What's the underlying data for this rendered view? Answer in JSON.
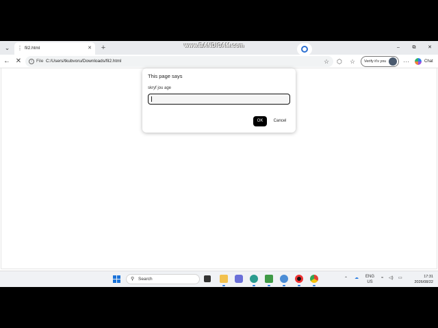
{
  "watermark": "www.BANDICAM.com",
  "tabs": [
    {
      "title": "fil2.html"
    }
  ],
  "address": {
    "scheme": "File",
    "url": "C:/Users/tkubvoru/Downloads/fil2.html"
  },
  "profile": {
    "label": "Verify it's you"
  },
  "chat": {
    "label": "Chat"
  },
  "dialog": {
    "title": "This page says",
    "message": "skryf jou age",
    "input_value": "",
    "ok_label": "OK",
    "cancel_label": "Cancel"
  },
  "taskbar": {
    "search_placeholder": "Search",
    "language_line1": "ENG",
    "language_line2": "US",
    "time": "17:31",
    "date": "2026/08/22"
  },
  "colors": {
    "accent": "#1a73d9",
    "dialog_ok": "#000000",
    "page_bg": "#ffffff",
    "chrome_bg": "#e9ebee"
  },
  "icons": [
    "tab-list-icon",
    "page-icon",
    "close-icon",
    "plus-icon",
    "minimize-icon",
    "restore-icon",
    "back-icon",
    "stop-icon",
    "info-icon",
    "star-icon",
    "extensions-icon",
    "favorites-icon",
    "more-icon",
    "copilot-icon",
    "windows-start-icon",
    "search-icon",
    "wifi-icon",
    "volume-icon",
    "battery-icon"
  ]
}
